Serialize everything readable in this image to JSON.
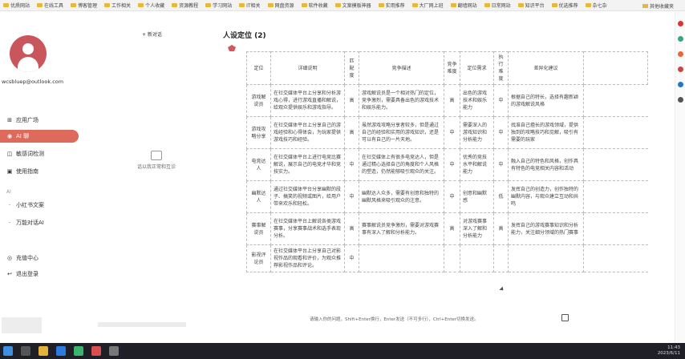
{
  "bookmarks": [
    "优质网站",
    "在线工具",
    "博客管理",
    "工作相关",
    "个人收藏",
    "资源教程",
    "学习网站",
    "IT相关",
    "网盘资源",
    "软件收藏",
    "文案模板神器",
    "实用推荐",
    "大厂网上班",
    "翻墙网站",
    "日常网站",
    "知识平台",
    "优选推荐",
    "杂七杂"
  ],
  "bookmarks_right": "其他收藏夹",
  "sidebar": {
    "new_chat": "+ 新对话",
    "email": "wcsbluep@outlook.com",
    "nav": [
      "应用广场",
      "AI 聊",
      "敏感词检测",
      "使用指南"
    ],
    "section_label": "AI",
    "nav2": [
      "小红书文案",
      "万能对话AI"
    ],
    "nav3": [
      "充值中心",
      "退出登录"
    ]
  },
  "empty_panel": "话以我正常和互诊",
  "main": {
    "title": "人设定位 (2)",
    "headers": [
      "定位",
      "详细说明",
      "匹配度",
      "竞争描述",
      "竞争难度",
      "定位需求",
      "执行难度",
      "差异化建议"
    ],
    "rows": [
      [
        "游戏解说员",
        "在社交媒体平台上分享和分析游戏心得，进行游戏直播和解说，给观众提供娱乐和游戏指导。",
        "高",
        "游戏解说员是一个相对热门的定位，竞争激烈，需要具备出色的游戏技术和娱乐能力。",
        "高",
        "出色的游戏技术和娱乐能力",
        "中",
        "根据自己的特长，选择有趣新颖的游戏解说风格"
      ],
      [
        "游戏攻略分享",
        "在社交媒体平台上分享自己的游戏经验和心得体会，为玩家提供游戏技巧和经验。",
        "高",
        "虽然游戏攻略分享者较多，但是通过自己的经验和实用的游戏知识，还是可以有自己的一片天地。",
        "中",
        "需要深入的游戏知识和分析能力",
        "中",
        "找准自己擅长的游戏领域，提供独到的攻略技巧和见解，吸引有需要的玩家"
      ],
      [
        "电竞达人",
        "在社交媒体平台上进行电竞比赛解说，展示自己的电竞才华和竞技实力。",
        "中",
        "在社交媒体上有很多电竞达人，但是通过精心选择自己的角度和个人风格的塑造，仍然能够吸引观众的关注。",
        "中",
        "优秀的竞技水平和解说能力",
        "中",
        "融入自己的特色和风格，创作具有特色的电竞相关内容和活动"
      ],
      [
        "幽默达人",
        "通过社交媒体平台分享幽默的段子、搞笑的视频或图片，给用户带来欢乐和轻松。",
        "中",
        "幽默达人众多，需要有创意和独特的幽默风格来吸引观众的注意。",
        "中",
        "创意和幽默感",
        "低",
        "发挥自己的创造力，创作独特的幽默内容，与观众建立互动和共鸣"
      ],
      [
        "赛事解说员",
        "在社交媒体平台上解说各类游戏赛事，分享赛事战术和选手表现分析。",
        "高",
        "赛事解说员竞争激烈，需要对游戏赛事有深入了解和分析能力。",
        "高",
        "对游戏赛事深入了解和分析能力",
        "高",
        "发挥自己的游戏赛事知识和分析能力，关注细分领域的热门赛事"
      ],
      [
        "影视评论员",
        "在社交媒体平台上分享自己对影视作品的观看和评价，为观众推荐影视作品和评论。",
        "中",
        "",
        "",
        "",
        "",
        ""
      ]
    ]
  },
  "bottom_hint": "请输入你的问题，Shift+Enter换行，Enter发送（不可多行），Ctrl+Enter切换发送。",
  "taskbar": {
    "time": "11:43",
    "date": "2023/6/11"
  }
}
